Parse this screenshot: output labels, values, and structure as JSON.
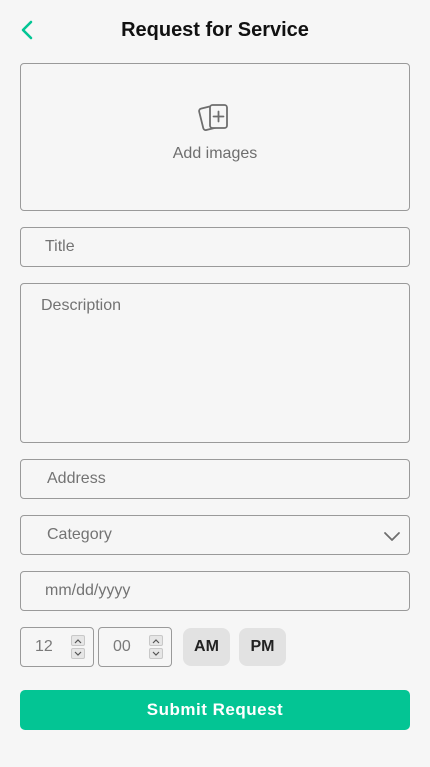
{
  "header": {
    "title": "Request for Service",
    "back_icon": "chevron-left-icon"
  },
  "colors": {
    "accent": "#03c594",
    "background": "#f6f6f6",
    "border": "#9a9a9a",
    "placeholder": "#737373"
  },
  "form": {
    "images": {
      "label": "Add images",
      "icon": "add-image-cards-icon"
    },
    "title": {
      "placeholder": "Title",
      "value": ""
    },
    "description": {
      "placeholder": "Description",
      "value": ""
    },
    "address": {
      "placeholder": "Address",
      "value": ""
    },
    "category": {
      "selected": "Category",
      "icon": "chevron-down-icon"
    },
    "date": {
      "placeholder": "mm/dd/yyyy",
      "value": ""
    },
    "time": {
      "hour": "12",
      "minute": "00",
      "am_label": "AM",
      "pm_label": "PM"
    },
    "submit_label": "Submit Request"
  }
}
